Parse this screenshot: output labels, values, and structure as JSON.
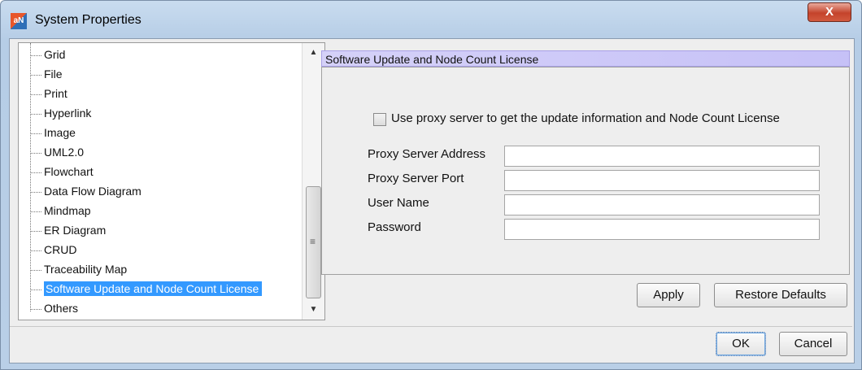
{
  "window": {
    "title": "System Properties",
    "app_icon_text": "aN",
    "close_glyph": "X"
  },
  "tree": {
    "items": [
      {
        "label": "Grid"
      },
      {
        "label": "File"
      },
      {
        "label": "Print"
      },
      {
        "label": "Hyperlink"
      },
      {
        "label": "Image"
      },
      {
        "label": "UML2.0"
      },
      {
        "label": "Flowchart"
      },
      {
        "label": "Data Flow Diagram"
      },
      {
        "label": "Mindmap"
      },
      {
        "label": "ER Diagram"
      },
      {
        "label": "CRUD"
      },
      {
        "label": "Traceability Map"
      },
      {
        "label": "Software Update and Node Count License"
      },
      {
        "label": "Others"
      }
    ],
    "selected_label": "Software Update and Node Count License",
    "scroll_up_glyph": "▲",
    "scroll_down_glyph": "▼",
    "thumb_grip": "≡"
  },
  "panel": {
    "header": "Software Update and Node Count License",
    "use_proxy_label": "Use proxy server to get the update information and Node Count License",
    "use_proxy_checked": false,
    "fields": {
      "proxy_address": {
        "label": "Proxy Server Address",
        "value": ""
      },
      "proxy_port": {
        "label": "Proxy Server Port",
        "value": ""
      },
      "user_name": {
        "label": "User Name",
        "value": ""
      },
      "password": {
        "label": "Password",
        "value": ""
      }
    }
  },
  "buttons": {
    "apply": "Apply",
    "restore_defaults": "Restore Defaults",
    "ok": "OK",
    "cancel": "Cancel"
  },
  "colors": {
    "selection": "#3399ff",
    "header_bg": "#c9c4f7"
  }
}
